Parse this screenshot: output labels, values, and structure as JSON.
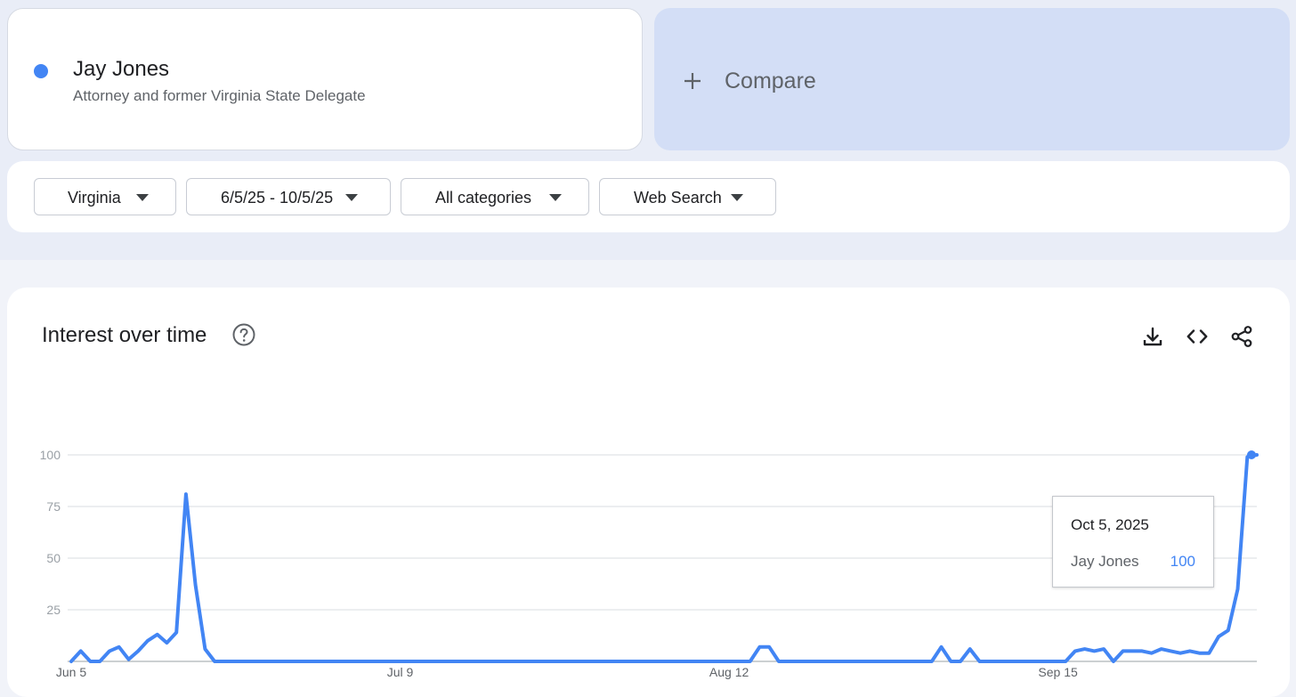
{
  "term": {
    "name": "Jay Jones",
    "description": "Attorney and former Virginia State Delegate",
    "color": "#4285f4"
  },
  "compare": {
    "label": "Compare",
    "icon": "plus-icon"
  },
  "filters": [
    {
      "label": "Virginia",
      "icon": "caret-down-icon"
    },
    {
      "label": "6/5/25 - 10/5/25",
      "icon": "caret-down-icon"
    },
    {
      "label": "All categories",
      "icon": "caret-down-icon"
    },
    {
      "label": "Web Search",
      "icon": "caret-down-icon"
    }
  ],
  "panel": {
    "title": "Interest over time",
    "help_icon": "help-icon",
    "actions": [
      "download-icon",
      "embed-code-icon",
      "share-icon"
    ]
  },
  "chart_data": {
    "type": "line",
    "xlabel": "",
    "ylabel": "",
    "ylim": [
      0,
      100
    ],
    "yticks": [
      100,
      75,
      50,
      25
    ],
    "xtick_labels": [
      "Jun 5",
      "Jul 9",
      "Aug 12",
      "Sep 15"
    ],
    "x_start": "2025-06-05",
    "x_end": "2025-10-05",
    "grid": true,
    "series": [
      {
        "color": "#4285f4",
        "values": [
          0,
          5,
          0,
          0,
          5,
          7,
          1,
          5,
          10,
          13,
          9,
          14,
          81,
          37,
          6,
          0,
          0,
          0,
          0,
          0,
          0,
          0,
          0,
          0,
          0,
          0,
          0,
          0,
          0,
          0,
          0,
          0,
          0,
          0,
          0,
          0,
          0,
          0,
          0,
          0,
          0,
          0,
          0,
          0,
          0,
          0,
          0,
          0,
          0,
          0,
          0,
          0,
          0,
          0,
          0,
          0,
          0,
          0,
          0,
          0,
          0,
          0,
          0,
          0,
          0,
          0,
          0,
          0,
          0,
          0,
          0,
          0,
          7,
          7,
          0,
          0,
          0,
          0,
          0,
          0,
          0,
          0,
          0,
          0,
          0,
          0,
          0,
          0,
          0,
          0,
          0,
          7,
          0,
          0,
          6,
          0,
          0,
          0,
          0,
          0,
          0,
          0,
          0,
          0,
          0,
          5,
          6,
          5,
          6,
          0,
          5,
          5,
          5,
          4,
          6,
          5,
          4,
          5,
          4,
          4,
          12,
          15,
          35,
          99,
          100
        ]
      }
    ],
    "tooltip": {
      "date": "Oct 5, 2025",
      "series": "Jay Jones",
      "value": "100"
    }
  }
}
